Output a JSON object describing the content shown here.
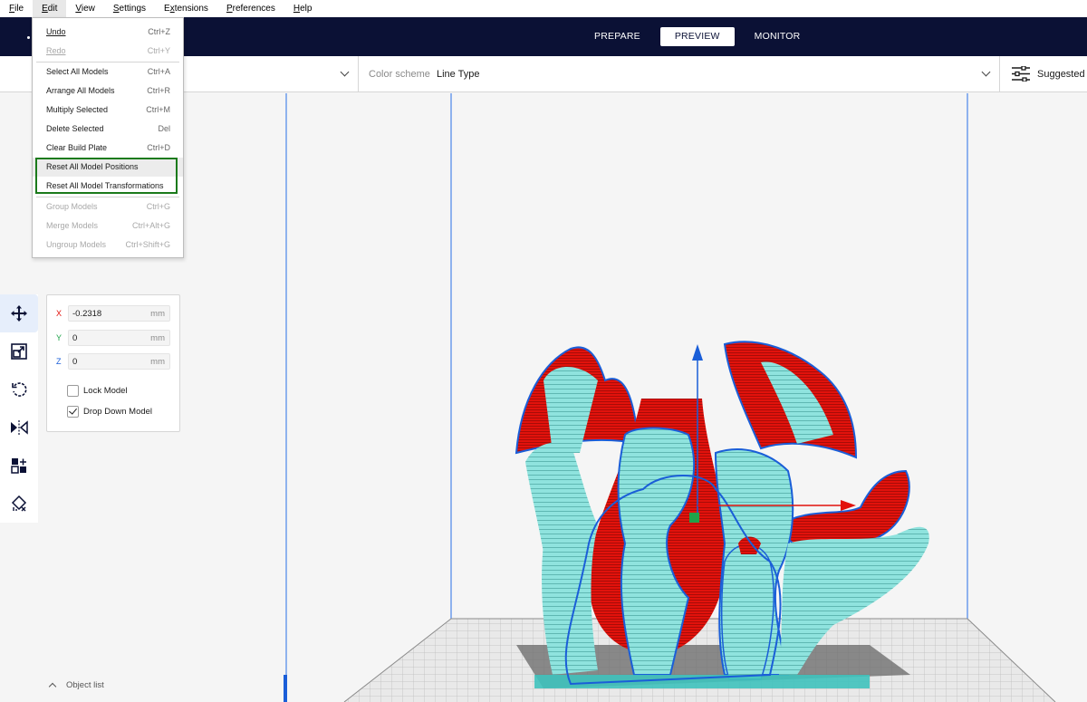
{
  "menubar": {
    "items": [
      {
        "label": "File",
        "accel": "F",
        "rest": "ile"
      },
      {
        "label": "Edit",
        "accel": "E",
        "rest": "dit"
      },
      {
        "label": "View",
        "accel": "V",
        "rest": "iew"
      },
      {
        "label": "Settings",
        "accel": "S",
        "rest": "ettings"
      },
      {
        "label": "Extensions",
        "accel": "x",
        "pre": "E",
        "rest": "tensions"
      },
      {
        "label": "Preferences",
        "accel": "P",
        "rest": "references"
      },
      {
        "label": "Help",
        "accel": "H",
        "rest": "elp"
      }
    ]
  },
  "header": {
    "tabs": [
      "PREPARE",
      "PREVIEW",
      "MONITOR"
    ],
    "active_tab": "PREVIEW"
  },
  "toolbar": {
    "color_scheme_label": "Color scheme",
    "color_scheme_value": "Line Type",
    "suggested_label": "Suggested"
  },
  "edit_menu": {
    "items": [
      {
        "label": "Undo",
        "shortcut": "Ctrl+Z",
        "disabled": false
      },
      {
        "label": "Redo",
        "shortcut": "Ctrl+Y",
        "disabled": true
      },
      {
        "label": "Select All Models",
        "shortcut": "Ctrl+A",
        "disabled": false
      },
      {
        "label": "Arrange All Models",
        "shortcut": "Ctrl+R",
        "disabled": false
      },
      {
        "label": "Multiply Selected",
        "shortcut": "Ctrl+M",
        "disabled": false
      },
      {
        "label": "Delete Selected",
        "shortcut": "Del",
        "disabled": false
      },
      {
        "label": "Clear Build Plate",
        "shortcut": "Ctrl+D",
        "disabled": false
      },
      {
        "label": "Reset All Model Positions",
        "shortcut": "",
        "disabled": false
      },
      {
        "label": "Reset All Model Transformations",
        "shortcut": "",
        "disabled": false
      },
      {
        "label": "Group Models",
        "shortcut": "Ctrl+G",
        "disabled": true
      },
      {
        "label": "Merge Models",
        "shortcut": "Ctrl+Alt+G",
        "disabled": true
      },
      {
        "label": "Ungroup Models",
        "shortcut": "Ctrl+Shift+G",
        "disabled": true
      }
    ]
  },
  "move_panel": {
    "x_label": "X",
    "x_value": "-0.2318",
    "x_unit": "mm",
    "y_label": "Y",
    "y_value": "0",
    "y_unit": "mm",
    "z_label": "Z",
    "z_value": "0",
    "z_unit": "mm",
    "lock_model_label": "Lock Model",
    "lock_model_checked": false,
    "drop_down_label": "Drop Down Model",
    "drop_down_checked": true
  },
  "left_tools": [
    "move-icon",
    "scale-icon",
    "rotate-icon",
    "mirror-icon",
    "per-model-settings-icon",
    "support-blocker-icon"
  ],
  "object_list": {
    "label": "Object list"
  },
  "colors": {
    "header_bg": "#0b1135",
    "accent_blue": "#1a5ed8",
    "model_cyan": "#8fe3de",
    "model_red": "#e2120c",
    "highlight_green": "#1b7a1b"
  }
}
